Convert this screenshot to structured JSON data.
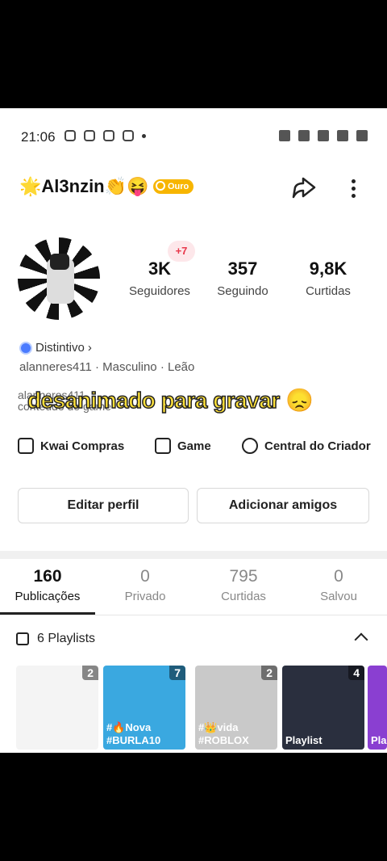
{
  "status_bar": {
    "time": "21:06"
  },
  "profile": {
    "name": "🌟Al3nzin👏😝",
    "badge": "Ouro",
    "followers_delta": "+7",
    "stats": [
      {
        "value": "3K",
        "label": "Seguidores"
      },
      {
        "value": "357",
        "label": "Seguindo"
      },
      {
        "value": "9,8K",
        "label": "Curtidas"
      }
    ],
    "distintivo": "Distintivo",
    "distintivo_chevron": "›",
    "info": "alanneres411 · Masculino · Leão",
    "bio": "alanneres411\nconteúdo de game"
  },
  "caption": {
    "text": "desanimado para gravar",
    "emoji": "😞"
  },
  "quick_links": [
    {
      "label": "Kwai Compras"
    },
    {
      "label": "Game"
    },
    {
      "label": "Central do Criador"
    }
  ],
  "buttons": {
    "edit": "Editar perfil",
    "add": "Adicionar amigos"
  },
  "tabs": [
    {
      "value": "160",
      "label": "Publicações"
    },
    {
      "value": "0",
      "label": "Privado"
    },
    {
      "value": "795",
      "label": "Curtidas"
    },
    {
      "value": "0",
      "label": "Salvou"
    }
  ],
  "playlists": {
    "header": "6 Playlists",
    "items": [
      {
        "count": "2",
        "title": "",
        "bg": "#f4f4f4"
      },
      {
        "count": "7",
        "title": "#🔥Nova #BURLA10",
        "bg": "#3aa8e0"
      },
      {
        "count": "2",
        "title": "#👑vida #ROBLOX",
        "bg": "#c9c9c9"
      },
      {
        "count": "4",
        "title": "Playlist",
        "bg": "#2a2f3e"
      },
      {
        "count": "",
        "title": "Pla",
        "bg": "#8a3fd1"
      }
    ]
  },
  "colors": {
    "accent_gold": "#f7b500",
    "caption_yellow": "#ffe23a",
    "plus_red": "#e8374a"
  }
}
